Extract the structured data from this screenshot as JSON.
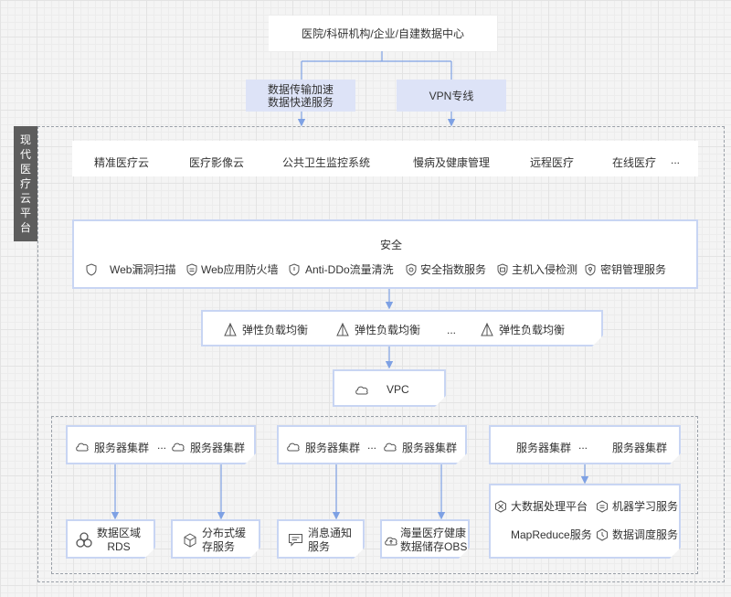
{
  "top_source": "医院/科研机构/企业/自建数据中心",
  "links": {
    "data_transfer": [
      "数据传输加速",
      "数据快递服务"
    ],
    "vpn": "VPN专线"
  },
  "platform_label": [
    "现",
    "代",
    "医",
    "疗",
    "云",
    "平",
    "台"
  ],
  "apps": [
    "精准医疗云",
    "医疗影像云",
    "公共卫生监控系统",
    "慢病及健康管理",
    "远程医疗",
    "在线医疗",
    "..."
  ],
  "security": {
    "title": "安全",
    "items": [
      "Web漏洞扫描",
      "Web应用防火墙",
      "Anti-DDo流量清洗",
      "安全指数服务",
      "主机入侵检测",
      "密钥管理服务"
    ]
  },
  "elb": [
    "弹性负载均衡",
    "弹性负载均衡",
    "...",
    "弹性负载均衡"
  ],
  "vpc": "VPC",
  "clusters": {
    "label": "服务器集群",
    "ellipsis": "..."
  },
  "services": {
    "rds": [
      "数据区域",
      "RDS"
    ],
    "cache": [
      "分布式缓",
      "存服务"
    ],
    "notify": [
      "消息通知",
      "服务"
    ],
    "obs": [
      "海量医疗健康",
      "数据储存OBS"
    ],
    "bigdata": [
      "大数据处理平台",
      "机器学习服务",
      "MapReduce服务",
      "数据调度服务"
    ]
  },
  "colors": {
    "line": "#7ea1e4",
    "card_border": "#c8d5f3",
    "link_fill": "#dde3f7",
    "label_bg": "#5d5d5d"
  }
}
